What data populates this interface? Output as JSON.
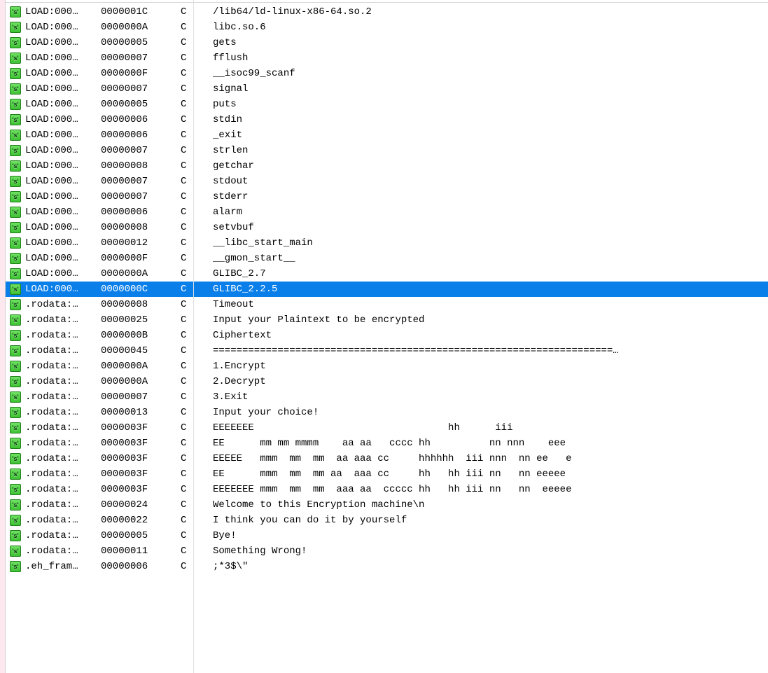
{
  "icon_label": "'s'",
  "selected_index": 18,
  "rows": [
    {
      "addr": "LOAD:000…",
      "len": "0000001C",
      "type": "C",
      "str": "/lib64/ld-linux-x86-64.so.2"
    },
    {
      "addr": "LOAD:000…",
      "len": "0000000A",
      "type": "C",
      "str": "libc.so.6"
    },
    {
      "addr": "LOAD:000…",
      "len": "00000005",
      "type": "C",
      "str": "gets"
    },
    {
      "addr": "LOAD:000…",
      "len": "00000007",
      "type": "C",
      "str": "fflush"
    },
    {
      "addr": "LOAD:000…",
      "len": "0000000F",
      "type": "C",
      "str": "__isoc99_scanf"
    },
    {
      "addr": "LOAD:000…",
      "len": "00000007",
      "type": "C",
      "str": "signal"
    },
    {
      "addr": "LOAD:000…",
      "len": "00000005",
      "type": "C",
      "str": "puts"
    },
    {
      "addr": "LOAD:000…",
      "len": "00000006",
      "type": "C",
      "str": "stdin"
    },
    {
      "addr": "LOAD:000…",
      "len": "00000006",
      "type": "C",
      "str": "_exit"
    },
    {
      "addr": "LOAD:000…",
      "len": "00000007",
      "type": "C",
      "str": "strlen"
    },
    {
      "addr": "LOAD:000…",
      "len": "00000008",
      "type": "C",
      "str": "getchar"
    },
    {
      "addr": "LOAD:000…",
      "len": "00000007",
      "type": "C",
      "str": "stdout"
    },
    {
      "addr": "LOAD:000…",
      "len": "00000007",
      "type": "C",
      "str": "stderr"
    },
    {
      "addr": "LOAD:000…",
      "len": "00000006",
      "type": "C",
      "str": "alarm"
    },
    {
      "addr": "LOAD:000…",
      "len": "00000008",
      "type": "C",
      "str": "setvbuf"
    },
    {
      "addr": "LOAD:000…",
      "len": "00000012",
      "type": "C",
      "str": "__libc_start_main"
    },
    {
      "addr": "LOAD:000…",
      "len": "0000000F",
      "type": "C",
      "str": "__gmon_start__"
    },
    {
      "addr": "LOAD:000…",
      "len": "0000000A",
      "type": "C",
      "str": "GLIBC_2.7"
    },
    {
      "addr": "LOAD:000…",
      "len": "0000000C",
      "type": "C",
      "str": "GLIBC_2.2.5"
    },
    {
      "addr": ".rodata:…",
      "len": "00000008",
      "type": "C",
      "str": "Timeout"
    },
    {
      "addr": ".rodata:…",
      "len": "00000025",
      "type": "C",
      "str": "Input your Plaintext to be encrypted"
    },
    {
      "addr": ".rodata:…",
      "len": "0000000B",
      "type": "C",
      "str": "Ciphertext"
    },
    {
      "addr": ".rodata:…",
      "len": "00000045",
      "type": "C",
      "str": "====================================================================…"
    },
    {
      "addr": ".rodata:…",
      "len": "0000000A",
      "type": "C",
      "str": "1.Encrypt"
    },
    {
      "addr": ".rodata:…",
      "len": "0000000A",
      "type": "C",
      "str": "2.Decrypt"
    },
    {
      "addr": ".rodata:…",
      "len": "00000007",
      "type": "C",
      "str": "3.Exit"
    },
    {
      "addr": ".rodata:…",
      "len": "00000013",
      "type": "C",
      "str": "Input your choice!"
    },
    {
      "addr": ".rodata:…",
      "len": "0000003F",
      "type": "C",
      "str": "EEEEEEE                                 hh      iii            "
    },
    {
      "addr": ".rodata:…",
      "len": "0000003F",
      "type": "C",
      "str": "EE      mm mm mmmm    aa aa   cccc hh          nn nnn    eee   "
    },
    {
      "addr": ".rodata:…",
      "len": "0000003F",
      "type": "C",
      "str": "EEEEE   mmm  mm  mm  aa aaa cc     hhhhhh  iii nnn  nn ee   e  "
    },
    {
      "addr": ".rodata:…",
      "len": "0000003F",
      "type": "C",
      "str": "EE      mmm  mm  mm aa  aaa cc     hh   hh iii nn   nn eeeee   "
    },
    {
      "addr": ".rodata:…",
      "len": "0000003F",
      "type": "C",
      "str": "EEEEEEE mmm  mm  mm  aaa aa  ccccc hh   hh iii nn   nn  eeeee  "
    },
    {
      "addr": ".rodata:…",
      "len": "00000024",
      "type": "C",
      "str": "Welcome to this Encryption machine\\n"
    },
    {
      "addr": ".rodata:…",
      "len": "00000022",
      "type": "C",
      "str": "I think you can do it by yourself"
    },
    {
      "addr": ".rodata:…",
      "len": "00000005",
      "type": "C",
      "str": "Bye!"
    },
    {
      "addr": ".rodata:…",
      "len": "00000011",
      "type": "C",
      "str": "Something Wrong!"
    },
    {
      "addr": ".eh_fram…",
      "len": "00000006",
      "type": "C",
      "str": ";*3$\\\""
    }
  ]
}
